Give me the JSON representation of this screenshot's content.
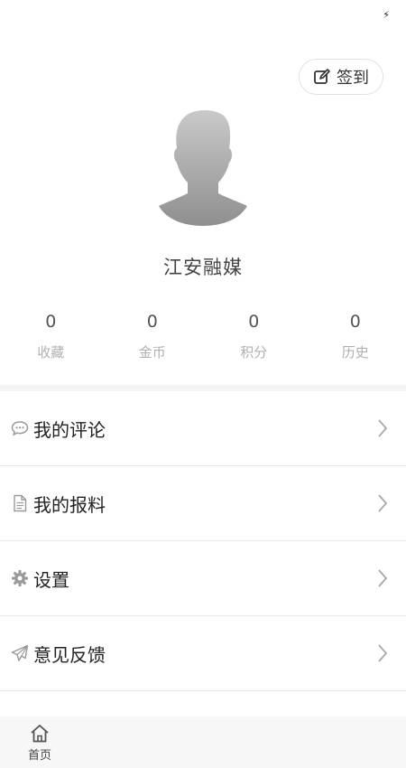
{
  "status_bar": {
    "icons": [
      "charging-bolt-icon"
    ]
  },
  "checkin": {
    "label": "签到",
    "icon": "edit-icon"
  },
  "profile": {
    "avatar": "default-avatar-silhouette",
    "username": "江安融媒"
  },
  "stats": [
    {
      "value": "0",
      "label": "收藏"
    },
    {
      "value": "0",
      "label": "金币"
    },
    {
      "value": "0",
      "label": "积分"
    },
    {
      "value": "0",
      "label": "历史"
    }
  ],
  "menu": [
    {
      "label": "我的评论",
      "icon": "comment-icon"
    },
    {
      "label": "我的报料",
      "icon": "document-icon"
    },
    {
      "label": "设置",
      "icon": "gear-icon"
    },
    {
      "label": "意见反馈",
      "icon": "paper-plane-icon"
    }
  ],
  "tabbar": {
    "items": [
      {
        "label": "首页",
        "icon": "home-icon"
      }
    ]
  },
  "colors": {
    "text": "#222222",
    "muted": "#b0b0b0",
    "divider": "#e8e8e8",
    "icon": "#999999"
  }
}
